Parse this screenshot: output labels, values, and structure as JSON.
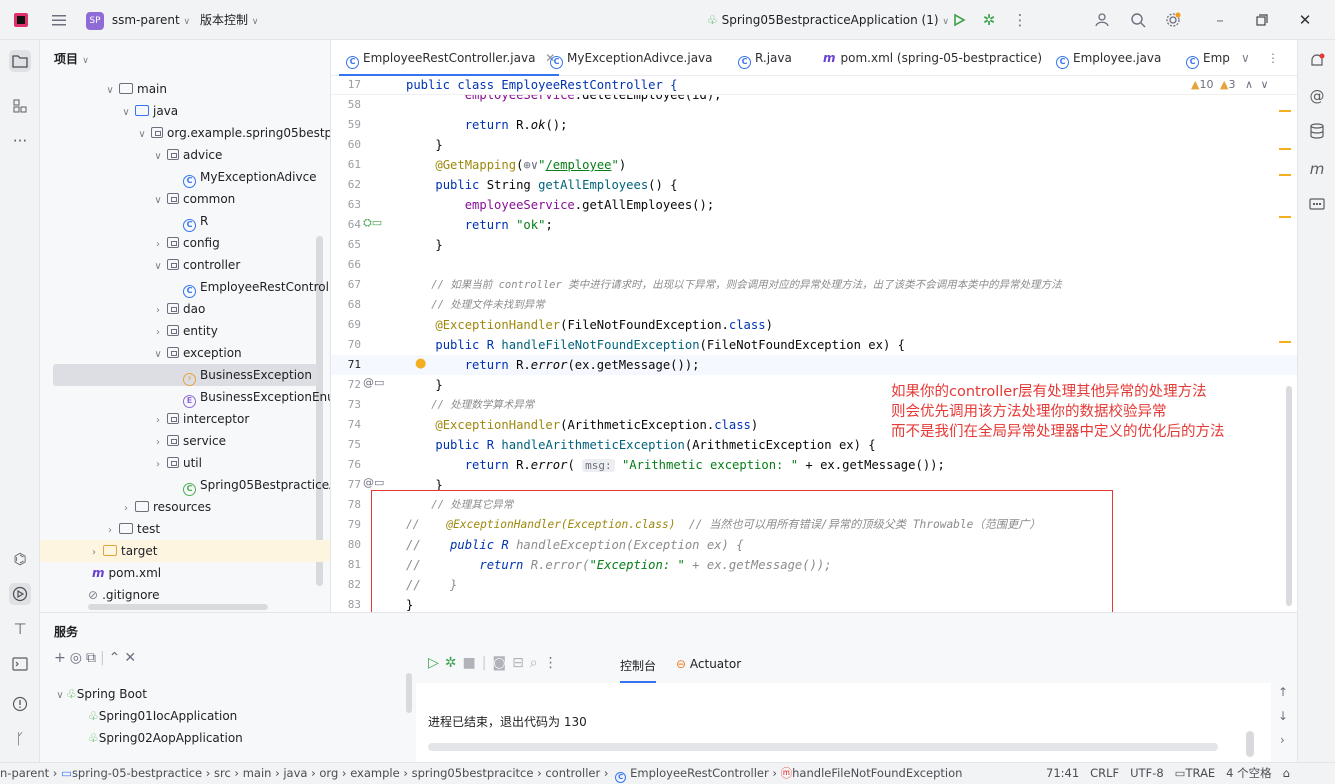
{
  "titlebar": {
    "project_badge": "SP",
    "project_name": "ssm-parent",
    "vcs": "版本控制",
    "run_config": "Spring05BestpracticeApplication (1)"
  },
  "project_panel": {
    "title": "项目",
    "items": [
      {
        "label": "main"
      },
      {
        "label": "java"
      },
      {
        "label": "org.example.spring05bestpra"
      },
      {
        "label": "advice"
      },
      {
        "label": "MyExceptionAdivce"
      },
      {
        "label": "common"
      },
      {
        "label": "R"
      },
      {
        "label": "config"
      },
      {
        "label": "controller"
      },
      {
        "label": "EmployeeRestControll"
      },
      {
        "label": "dao"
      },
      {
        "label": "entity"
      },
      {
        "label": "exception"
      },
      {
        "label": "BusinessException"
      },
      {
        "label": "BusinessExceptionEnu"
      },
      {
        "label": "interceptor"
      },
      {
        "label": "service"
      },
      {
        "label": "util"
      },
      {
        "label": "Spring05BestpracticeAppl"
      },
      {
        "label": "resources"
      },
      {
        "label": "test"
      },
      {
        "label": "target"
      },
      {
        "label": "pom.xml"
      },
      {
        "label": ".gitignore"
      }
    ]
  },
  "tabs": [
    {
      "label": "EmployeeRestController.java",
      "icon": "class-icon"
    },
    {
      "label": "MyExceptionAdivce.java",
      "icon": "class-icon"
    },
    {
      "label": "R.java",
      "icon": "class-icon"
    },
    {
      "label": "pom.xml (spring-05-bestpractice)",
      "icon": "maven-icon"
    },
    {
      "label": "Employee.java",
      "icon": "class-icon"
    },
    {
      "label": "Emp",
      "icon": "class-icon"
    }
  ],
  "editor": {
    "sticky_header": "public class EmployeeRestController {",
    "warnings": "10",
    "weak_warnings": "3",
    "line_numbers": [
      "58",
      "59",
      "60",
      "61",
      "62",
      "63",
      "64",
      "65",
      "66",
      "67",
      "68",
      "69",
      "70",
      "71",
      "72",
      "73",
      "74",
      "75",
      "76",
      "77",
      "78",
      "79",
      "80",
      "81",
      "82",
      "83"
    ],
    "current_line": "71",
    "sticky_line_number": "17"
  },
  "annotation": {
    "line1": "如果你的controller层有处理其他异常的处理方法",
    "line2": "则会优先调用该方法处理你的数据校验异常",
    "line3": "而不是我们在全局异常处理器中定义的优化后的方法"
  },
  "services": {
    "title": "服务",
    "tree": [
      {
        "label": "Spring Boot"
      },
      {
        "label": "Spring01IocApplication"
      },
      {
        "label": "Spring02AopApplication"
      }
    ],
    "console_tab": "控制台",
    "actuator_tab": "Actuator",
    "console_output": "进程已结束，退出代码为 130"
  },
  "statusbar": {
    "breadcrumbs": [
      "n-parent",
      "spring-05-bestpractice",
      "src",
      "main",
      "java",
      "org",
      "example",
      "spring05bestpracitce",
      "controller",
      "EmployeeRestController",
      "handleFileNotFoundException"
    ],
    "position": "71:41",
    "line_sep": "CRLF",
    "encoding": "UTF-8",
    "plugin": "TRAE",
    "indent": "4 个空格"
  },
  "colors": {
    "accent": "#3574f0",
    "annotation": "#e53935",
    "warning": "#e6a23c"
  }
}
